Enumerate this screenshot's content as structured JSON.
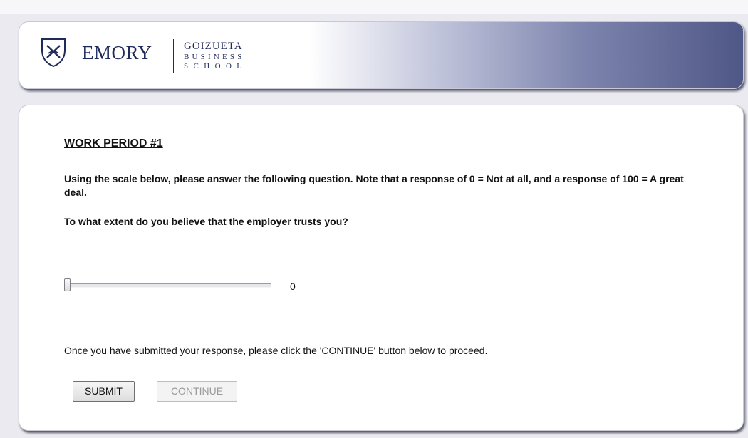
{
  "header": {
    "logo_primary": "EMORY",
    "logo_secondary_line1": "GOIZUETA",
    "logo_secondary_line2": "BUSINESS",
    "logo_secondary_line3": "SCHOOL",
    "brand_color": "#1f2b5a"
  },
  "content": {
    "title": "WORK PERIOD #1",
    "instructions": "Using the scale below, please answer the following question.  Note that a response of 0 = Not at all, and a response of 100 = A great deal.",
    "question": "To what extent do you believe that the employer trusts you?",
    "slider": {
      "min": 0,
      "max": 100,
      "value": 0,
      "value_label": "0"
    },
    "note": "Once you have submitted your response, please click the 'CONTINUE' button below to proceed.",
    "submit_label": "SUBMIT",
    "continue_label": "CONTINUE",
    "continue_enabled": false
  }
}
